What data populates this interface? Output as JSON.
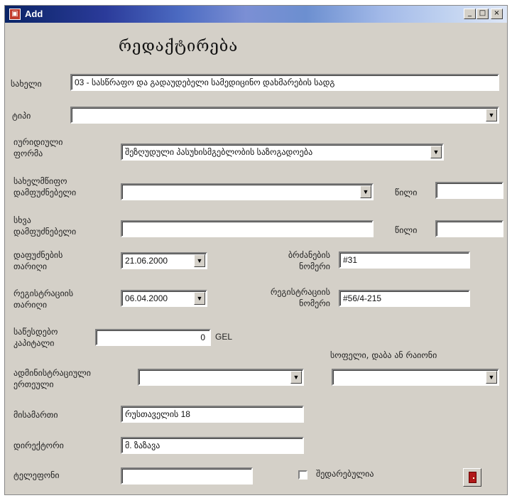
{
  "window": {
    "title": "Add",
    "minimize": "_",
    "maximize": "□",
    "close": "×"
  },
  "heading": "რედაქტირება",
  "labels": {
    "name": "სახელი",
    "type": "ტიპი",
    "legal_form_1": "იურიდიული",
    "legal_form_2": "ფორმა",
    "gov_founder_1": "სახელმწიფო",
    "gov_founder_2": "დამფუძნებელი",
    "year_1": "წილი",
    "other_founder_1": "სხვა",
    "other_founder_2": "დამფუძნებელი",
    "year_2": "წილი",
    "founding_date_1": "დაფუძნების",
    "founding_date_2": "თარიღი",
    "order_no_1": "ბრძანების",
    "order_no_2": "ნომერი",
    "reg_date_1": "რეგისტრაციის",
    "reg_date_2": "თარიღი",
    "reg_no_1": "რეგისტრაციის",
    "reg_no_2": "ნომერი",
    "capital_1": "საწესდებო",
    "capital_2": "კაპიტალი",
    "currency": "GEL",
    "village": "სოფელი, დაბა ან რაიონი",
    "admin_unit_1": "ადმინისტრაციული",
    "admin_unit_2": "ერთეული",
    "address": "მისამართი",
    "director": "დირექტორი",
    "phone": "ტელეფონი",
    "verified": "შედარებულია"
  },
  "values": {
    "name": "03 - სასწრაფო და გადაუდებელი სამედიცინო დახმარების სადგ",
    "type": "",
    "legal_form": "შეზღუდული პასუხისმგებლობის საზოგადოება",
    "gov_founder": "",
    "year_1": "",
    "other_founder": "",
    "year_2": "",
    "founding_date": "21.06.2000",
    "order_no": "#31",
    "reg_date": "06.04.2000",
    "reg_no": "#56/4-215",
    "capital": "0",
    "village": "",
    "admin_unit": "",
    "address": "რუსთაველის 18",
    "director": "მ. ზაზავა",
    "phone": "",
    "verified": false
  },
  "icons": {
    "dropdown": "▼",
    "app": "app-icon",
    "exit": "door-exit-icon"
  }
}
